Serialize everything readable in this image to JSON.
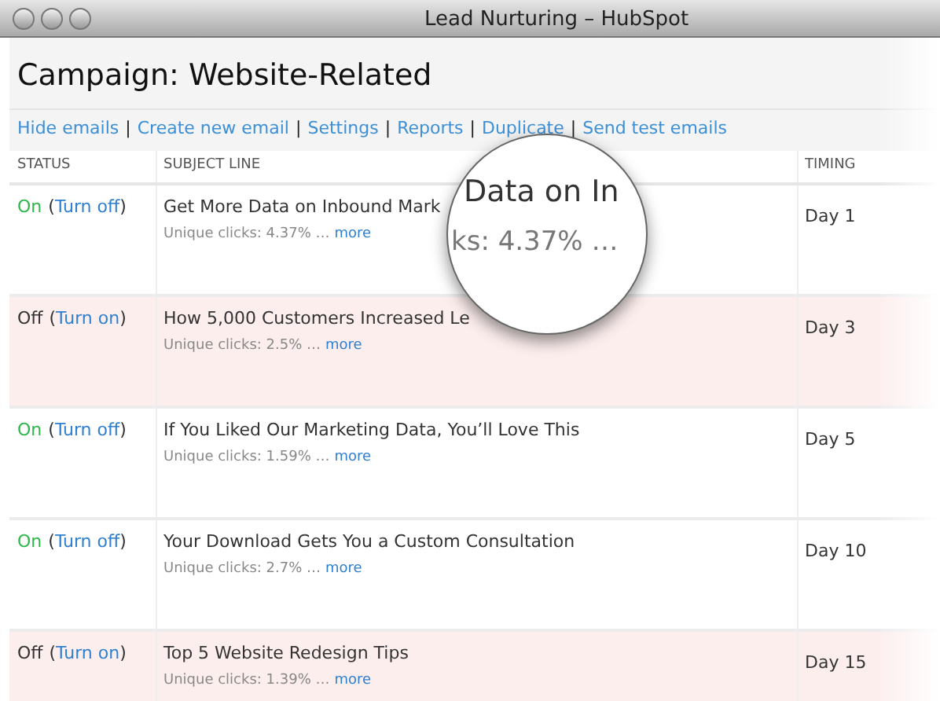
{
  "window": {
    "title": "Lead Nurturing – HubSpot"
  },
  "heading": "Campaign: Website-Related",
  "actions": {
    "separator": "|",
    "links": [
      "Hide emails",
      "Create new email",
      "Settings",
      "Reports",
      "Duplicate",
      "Send test emails"
    ]
  },
  "table": {
    "columns": [
      "STATUS",
      "SUBJECT LINE",
      "TIMING"
    ],
    "rows": [
      {
        "on": true,
        "status": "On",
        "toggle": "(Turn off)",
        "subject": "Get More Data on Inbound Mark",
        "clicks": "Unique clicks: 4.37% …",
        "more": "more",
        "timing": "Day 1"
      },
      {
        "on": false,
        "status": "Off",
        "toggle": "(Turn on)",
        "subject": "How 5,000 Customers Increased Le",
        "clicks": "Unique clicks: 2.5% …",
        "more": "more",
        "timing": "Day 3"
      },
      {
        "on": true,
        "status": "On",
        "toggle": "(Turn off)",
        "subject": "If You Liked Our Marketing Data, You’ll Love This",
        "clicks": "Unique clicks: 1.59% …",
        "more": "more",
        "timing": "Day 5"
      },
      {
        "on": true,
        "status": "On",
        "toggle": "(Turn off)",
        "subject": "Your Download Gets You a Custom Consultation",
        "clicks": "Unique clicks: 2.7% …",
        "more": "more",
        "timing": "Day 10"
      },
      {
        "on": false,
        "status": "Off",
        "toggle": "(Turn on)",
        "subject": "Top 5 Website Redesign Tips",
        "clicks": "Unique clicks: 1.39% …",
        "more": "more",
        "timing": "Day 15"
      }
    ]
  },
  "magnifier": {
    "lines": [
      "Data on In",
      "ks: 4.37% …"
    ]
  }
}
